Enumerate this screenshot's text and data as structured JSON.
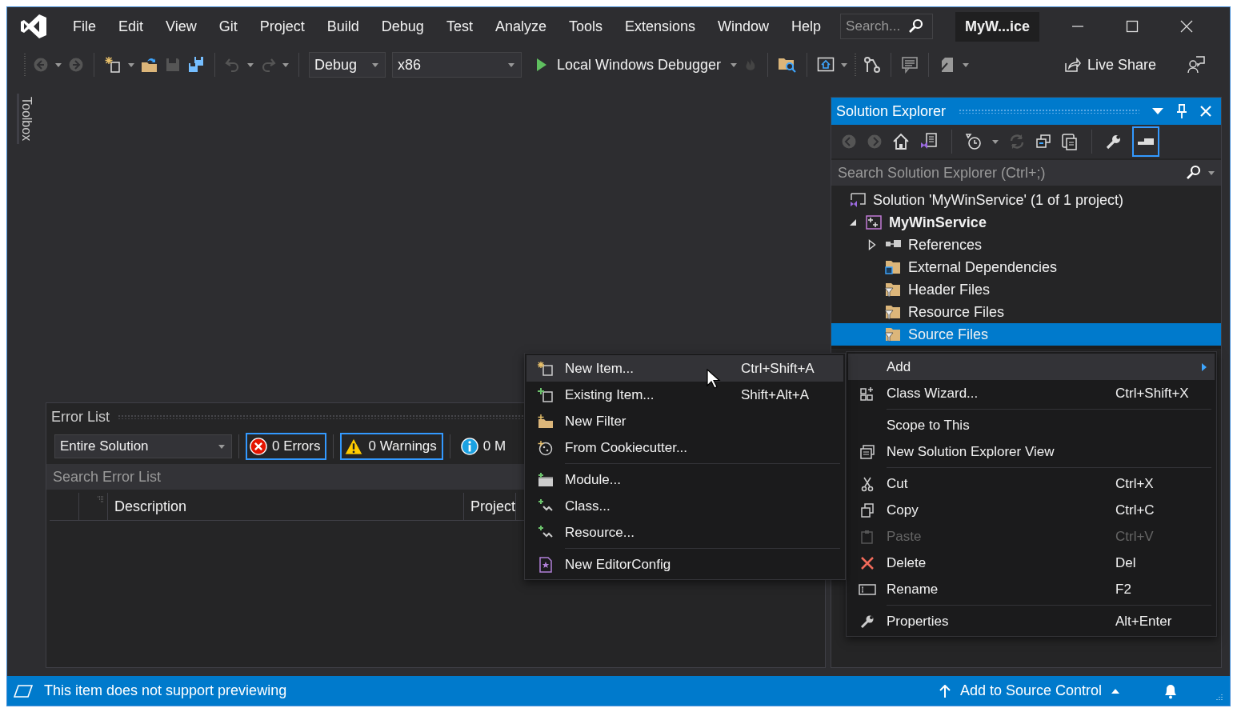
{
  "window": {
    "title": "MyW...ice"
  },
  "menu_bar": [
    "File",
    "Edit",
    "View",
    "Git",
    "Project",
    "Build",
    "Debug",
    "Test",
    "Analyze",
    "Tools",
    "Extensions",
    "Window",
    "Help"
  ],
  "search": {
    "placeholder": "Search..."
  },
  "toolbar": {
    "configuration": "Debug",
    "platform": "x86",
    "run_target": "Local Windows Debugger",
    "live_share": "Live Share"
  },
  "toolbox": {
    "label": "Toolbox"
  },
  "error_list": {
    "title": "Error List",
    "scope": "Entire Solution",
    "filters": [
      {
        "kind": "error",
        "label": "0 Errors",
        "selected": true
      },
      {
        "kind": "warning",
        "label": "0 Warnings",
        "selected": true
      },
      {
        "kind": "message",
        "label": "0 M",
        "selected": false
      }
    ],
    "search": {
      "placeholder": "Search Error List"
    },
    "columns": [
      "Description",
      "Project"
    ]
  },
  "solution_explorer": {
    "title": "Solution Explorer",
    "search": {
      "placeholder": "Search Solution Explorer (Ctrl+;)"
    },
    "tree": [
      {
        "kind": "solution",
        "label": "Solution 'MyWinService' (1 of 1 project)",
        "selected": false,
        "children": [
          {
            "kind": "project",
            "label": "MyWinService",
            "selected": false,
            "expanded": true,
            "children": [
              {
                "kind": "references",
                "label": "References",
                "selected": false,
                "expanded": false
              },
              {
                "kind": "external",
                "label": "External Dependencies",
                "selected": false
              },
              {
                "kind": "filter",
                "label": "Header Files",
                "selected": false
              },
              {
                "kind": "filter",
                "label": "Resource Files",
                "selected": false
              },
              {
                "kind": "filter",
                "label": "Source Files",
                "selected": true
              }
            ]
          }
        ]
      }
    ]
  },
  "context_menu": {
    "items": [
      {
        "kind": "submenu",
        "label": "Add",
        "highlighted": true,
        "disabled": false
      },
      {
        "kind": "command",
        "label": "Class Wizard...",
        "shortcut": "Ctrl+Shift+X",
        "highlighted": false,
        "disabled": false
      },
      {
        "kind": "separator"
      },
      {
        "kind": "command",
        "label": "Scope to This",
        "highlighted": false,
        "disabled": false
      },
      {
        "kind": "command",
        "label": "New Solution Explorer View",
        "highlighted": false,
        "disabled": false
      },
      {
        "kind": "separator"
      },
      {
        "kind": "command",
        "label": "Cut",
        "shortcut": "Ctrl+X",
        "highlighted": false,
        "disabled": false
      },
      {
        "kind": "command",
        "label": "Copy",
        "shortcut": "Ctrl+C",
        "highlighted": false,
        "disabled": false
      },
      {
        "kind": "command",
        "label": "Paste",
        "shortcut": "Ctrl+V",
        "highlighted": false,
        "disabled": true
      },
      {
        "kind": "command",
        "label": "Delete",
        "shortcut": "Del",
        "highlighted": false,
        "disabled": false
      },
      {
        "kind": "command",
        "label": "Rename",
        "shortcut": "F2",
        "highlighted": false,
        "disabled": false
      },
      {
        "kind": "separator"
      },
      {
        "kind": "command",
        "label": "Properties",
        "shortcut": "Alt+Enter",
        "highlighted": false,
        "disabled": false
      }
    ]
  },
  "add_submenu": {
    "items": [
      {
        "kind": "command",
        "label": "New Item...",
        "shortcut": "Ctrl+Shift+A",
        "highlighted": true
      },
      {
        "kind": "command",
        "label": "Existing Item...",
        "shortcut": "Shift+Alt+A",
        "highlighted": false
      },
      {
        "kind": "command",
        "label": "New Filter",
        "highlighted": false
      },
      {
        "kind": "command",
        "label": "From Cookiecutter...",
        "highlighted": false
      },
      {
        "kind": "separator"
      },
      {
        "kind": "command",
        "label": "Module...",
        "highlighted": false
      },
      {
        "kind": "command",
        "label": "Class...",
        "highlighted": false
      },
      {
        "kind": "command",
        "label": "Resource...",
        "highlighted": false
      },
      {
        "kind": "separator"
      },
      {
        "kind": "command",
        "label": "New EditorConfig",
        "highlighted": false
      }
    ]
  },
  "status_bar": {
    "message": "This item does not support previewing",
    "source_control": "Add to Source Control"
  }
}
